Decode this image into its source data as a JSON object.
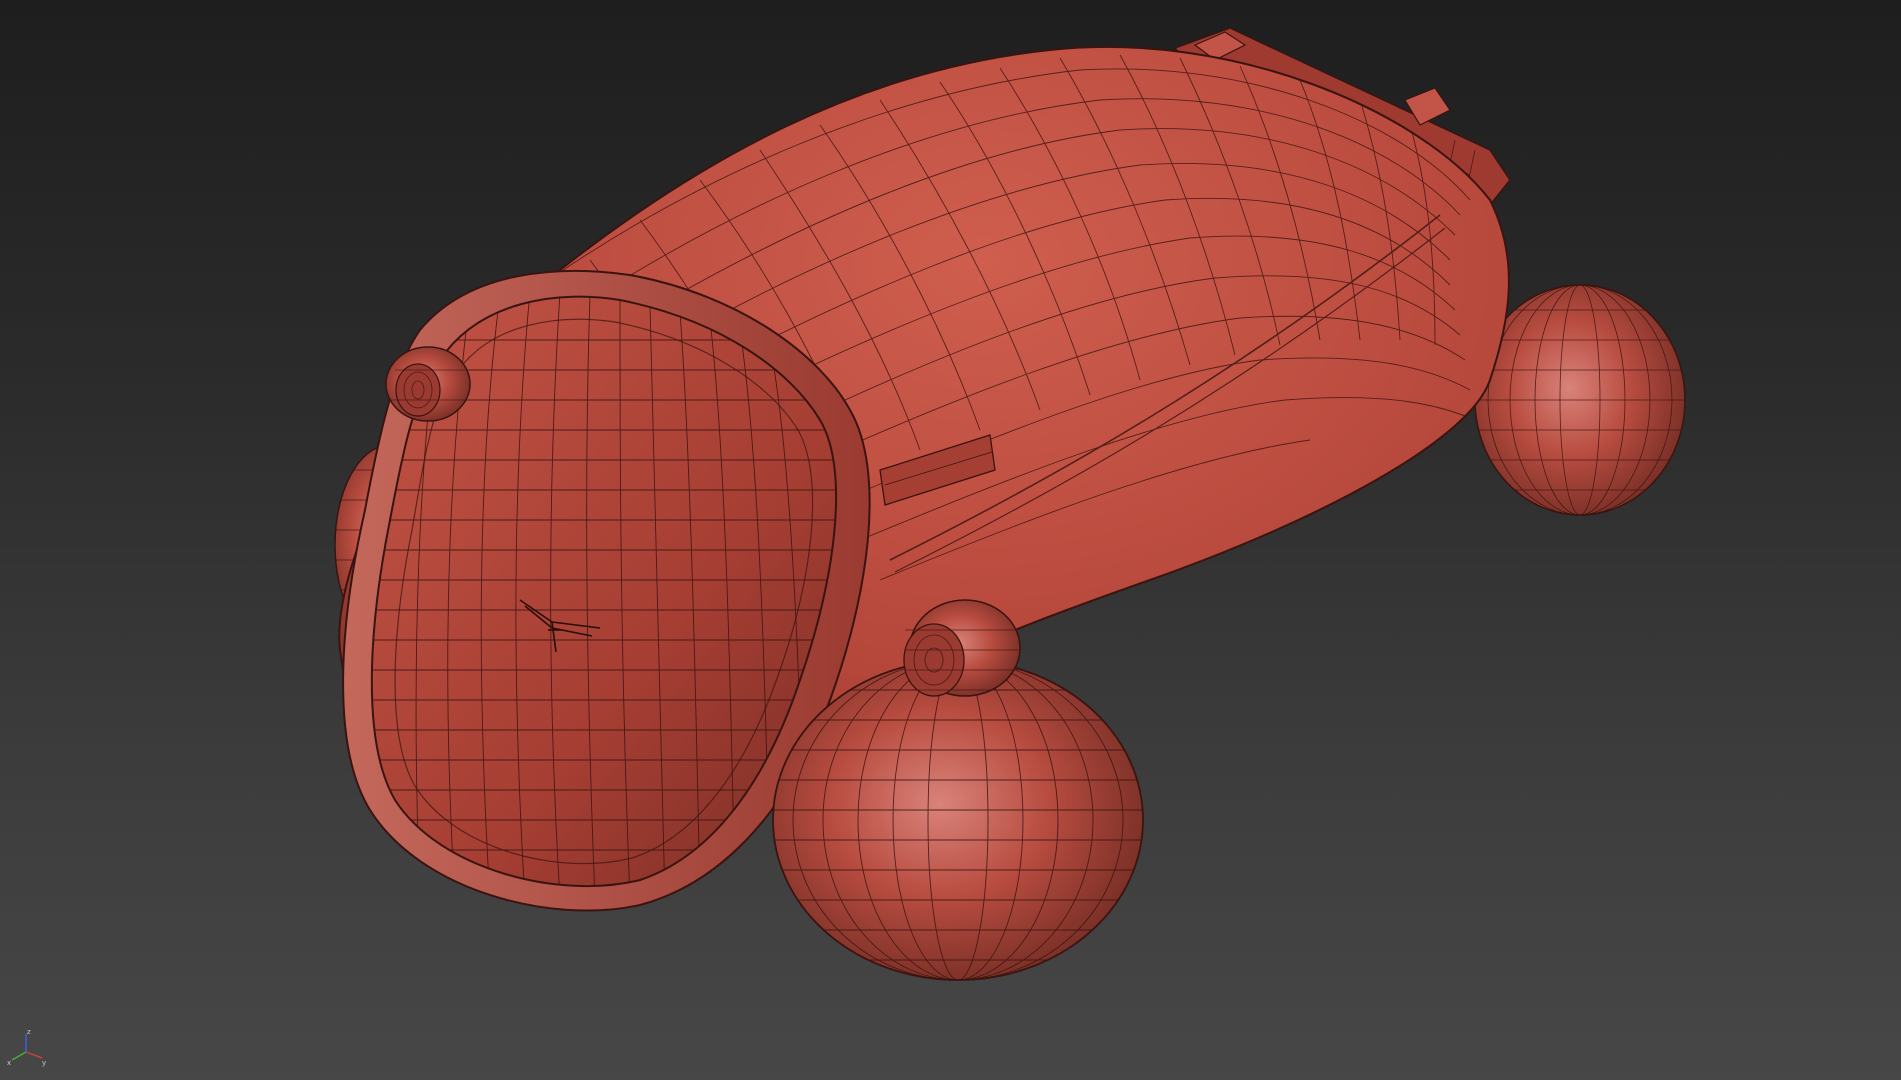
{
  "viewport": {
    "render_mode": "shaded-with-wireframe",
    "background_top": "#1e1e1e",
    "background_bottom": "#474747",
    "model": {
      "name": "",
      "base_color": "#b8483a",
      "highlight_color": "#d86a5a",
      "shadow_color": "#6e2a22",
      "wire_color": "#3a1410",
      "emblem_icon": "winged-emblem-icon"
    },
    "axis_gizmo": {
      "x_label": "x",
      "y_label": "y",
      "z_label": "z",
      "x_color": "#d04040",
      "y_color": "#40b040",
      "z_color": "#4060e0"
    }
  }
}
